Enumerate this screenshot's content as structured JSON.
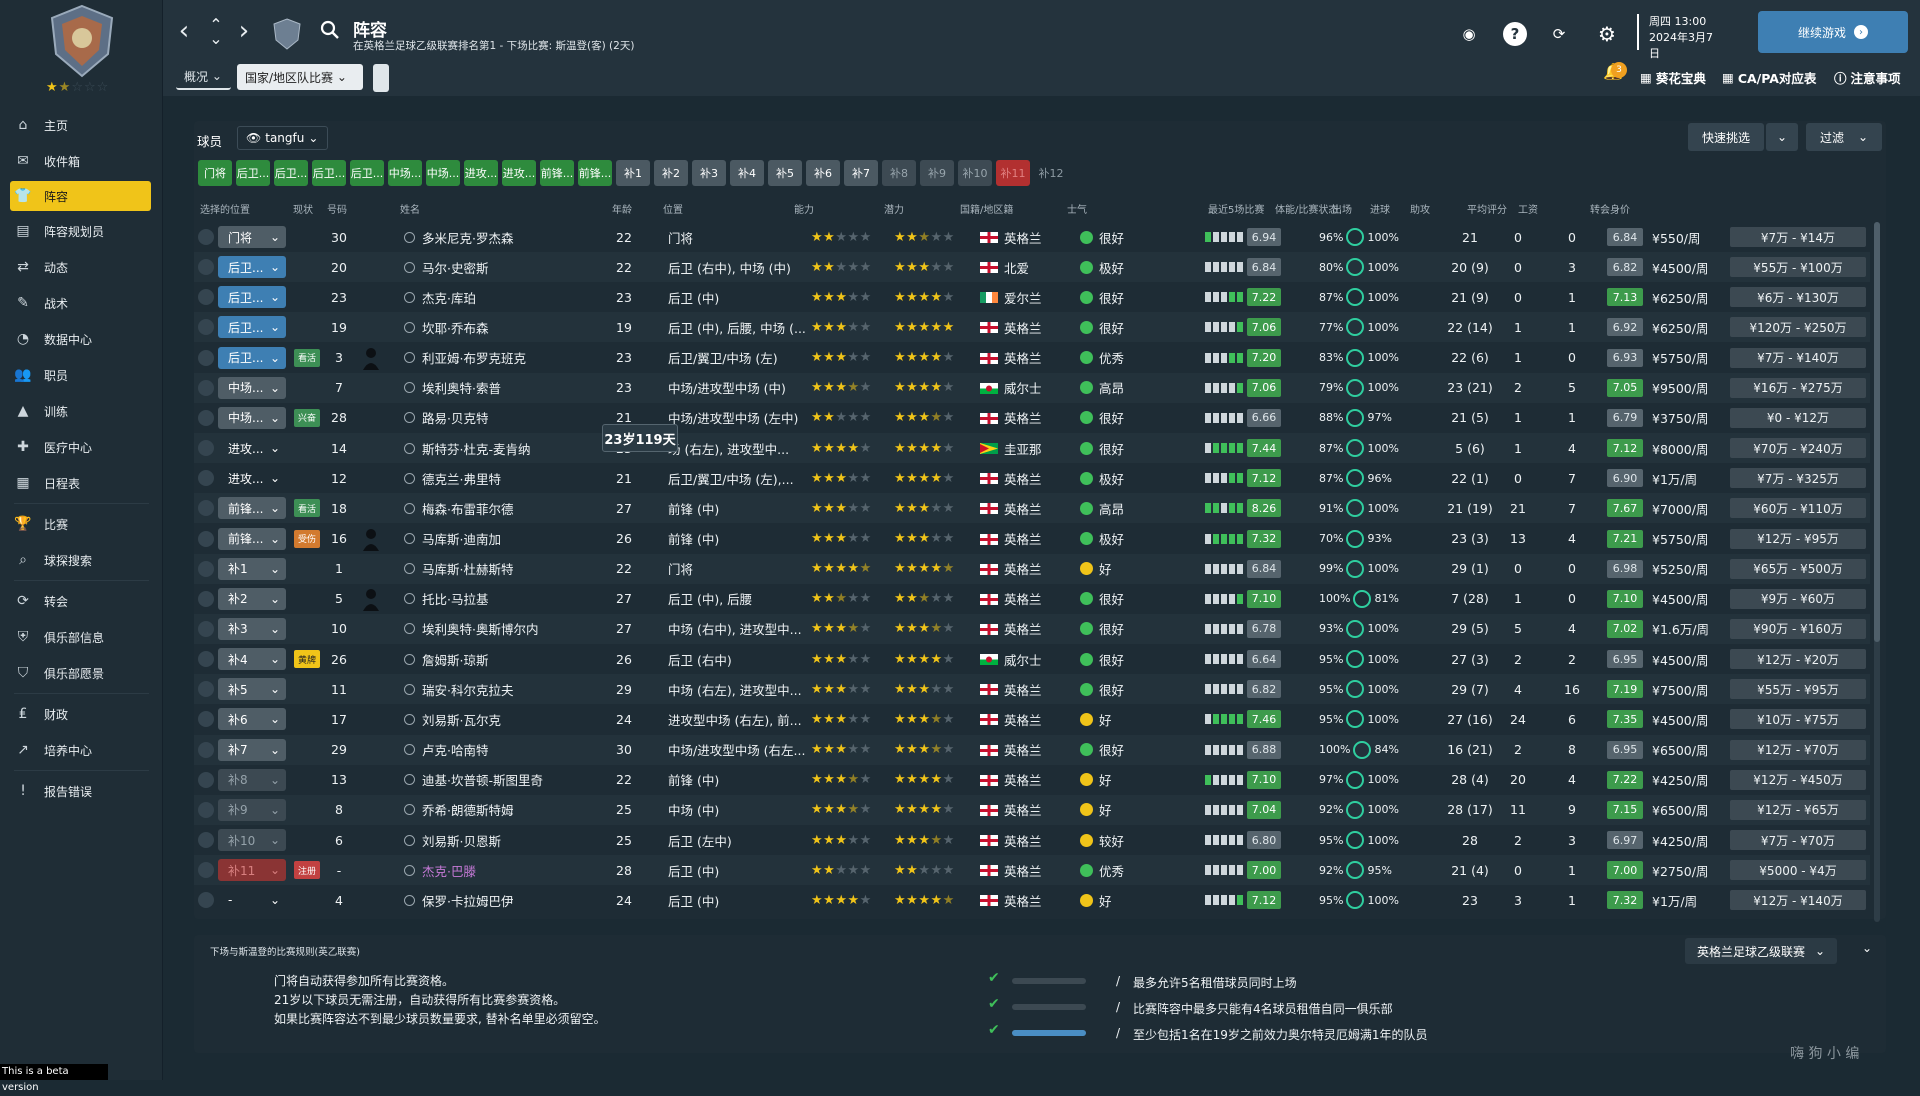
{
  "sidebar": {
    "stars": {
      "filled": "★",
      "half": "★",
      "empty": "☆☆☆"
    },
    "items": [
      {
        "label": "主页",
        "icon": "home-icon"
      },
      {
        "label": "收件箱",
        "icon": "inbox-icon"
      },
      {
        "label": "阵容",
        "icon": "squad-icon",
        "active": true
      },
      {
        "label": "阵容规划员",
        "icon": "planner-icon"
      },
      {
        "label": "动态",
        "icon": "dynamics-icon"
      },
      {
        "label": "战术",
        "icon": "tactics-icon"
      },
      {
        "label": "数据中心",
        "icon": "data-icon"
      },
      {
        "label": "职员",
        "icon": "staff-icon"
      },
      {
        "label": "训练",
        "icon": "training-icon"
      },
      {
        "label": "医疗中心",
        "icon": "medical-icon"
      },
      {
        "label": "日程表",
        "icon": "calendar-icon"
      },
      {
        "label": "比赛",
        "icon": "trophy-icon"
      },
      {
        "label": "球探搜索",
        "icon": "scout-icon"
      },
      {
        "label": "转会",
        "icon": "transfer-icon"
      },
      {
        "label": "俱乐部信息",
        "icon": "club-info-icon"
      },
      {
        "label": "俱乐部愿景",
        "icon": "vision-icon"
      },
      {
        "label": "财政",
        "icon": "finance-icon"
      },
      {
        "label": "培养中心",
        "icon": "development-icon"
      },
      {
        "label": "报告错误",
        "icon": "report-icon"
      }
    ],
    "beta": "This is a beta version"
  },
  "header": {
    "title": "阵容",
    "subtitle": "在英格兰足球乙级联赛排名第1 - 下场比赛: 斯温登(客) (2天)",
    "date_day": "周四 13:00",
    "date_full": "2024年3月7日",
    "continue": "继续游戏",
    "tabs": [
      {
        "label": "概况"
      },
      {
        "label": "国家/地区队比赛"
      }
    ],
    "links": [
      "葵花宝典",
      "CA/PA对应表",
      "注意事项"
    ],
    "notif_count": "3"
  },
  "panel": {
    "label": "球员",
    "view": "tangfu",
    "quick": "快速挑选",
    "filter": "过滤",
    "pos_tabs": [
      {
        "l": "门将",
        "t": "g"
      },
      {
        "l": "后卫...",
        "t": "g"
      },
      {
        "l": "后卫...",
        "t": "g"
      },
      {
        "l": "后卫...",
        "t": "g"
      },
      {
        "l": "后卫...",
        "t": "g"
      },
      {
        "l": "中场...",
        "t": "g"
      },
      {
        "l": "中场...",
        "t": "g"
      },
      {
        "l": "进攻...",
        "t": "g"
      },
      {
        "l": "进攻...",
        "t": "g"
      },
      {
        "l": "前锋...",
        "t": "g"
      },
      {
        "l": "前锋...",
        "t": "g"
      },
      {
        "l": "补1",
        "t": "s"
      },
      {
        "l": "补2",
        "t": "s"
      },
      {
        "l": "补3",
        "t": "s"
      },
      {
        "l": "补4",
        "t": "s"
      },
      {
        "l": "补5",
        "t": "s"
      },
      {
        "l": "补6",
        "t": "s"
      },
      {
        "l": "补7",
        "t": "s"
      },
      {
        "l": "补8",
        "t": "s2"
      },
      {
        "l": "补9",
        "t": "s2"
      },
      {
        "l": "补10",
        "t": "s2"
      },
      {
        "l": "补11",
        "t": "r"
      },
      {
        "l": "补12",
        "t": "n"
      }
    ],
    "columns": [
      "选择的位置",
      "现状",
      "号码",
      "姓名",
      "年龄",
      "位置",
      "能力",
      "潜力",
      "国籍/地区籍",
      "士气",
      "最近5场比赛",
      "体能/比赛状态",
      "出场",
      "进球",
      "助攻",
      "平均评分",
      "工资",
      "转会身价"
    ]
  },
  "tooltip": "23岁119天",
  "players": [
    {
      "sel": "门将",
      "sc": "gray",
      "badge": "",
      "bc": "",
      "num": "30",
      "sil": false,
      "name": "多米尼克·罗杰森",
      "age": "22",
      "pos": "门将",
      "ab": 2,
      "abh": 0,
      "po": 2,
      "poh": 1,
      "flag": "eng",
      "nat": "英格兰",
      "mor": "很好",
      "mc": "#3fbf5a",
      "fb": [
        1,
        0,
        0,
        0,
        0
      ],
      "fr": "6.94",
      "frc": "gray",
      "fit": "96%",
      "cond": "100%",
      "apps": "21",
      "g": "0",
      "a": "0",
      "avg": "6.84",
      "avgc": "gray",
      "wage": "¥550/周",
      "val": "¥7万 - ¥14万"
    },
    {
      "sel": "后卫...",
      "sc": "blue",
      "badge": "",
      "bc": "",
      "num": "20",
      "sil": false,
      "name": "马尔·史密斯",
      "age": "22",
      "pos": "后卫 (右中), 中场 (中)",
      "ab": 2,
      "abh": 0,
      "po": 3,
      "poh": 0,
      "flag": "nir",
      "nat": "北爱",
      "mor": "极好",
      "mc": "#3fbf5a",
      "fb": [
        0,
        0,
        0,
        0,
        0
      ],
      "fr": "6.84",
      "frc": "gray",
      "fit": "80%",
      "cond": "100%",
      "apps": "20 (9)",
      "g": "0",
      "a": "3",
      "avg": "6.82",
      "avgc": "gray",
      "wage": "¥4500/周",
      "val": "¥55万 - ¥100万"
    },
    {
      "sel": "后卫...",
      "sc": "blue",
      "badge": "",
      "bc": "",
      "num": "23",
      "sil": false,
      "name": "杰克·库珀",
      "age": "23",
      "pos": "后卫 (中)",
      "ab": 3,
      "abh": 0,
      "po": 4,
      "poh": 0,
      "flag": "irl",
      "nat": "爱尔兰",
      "mor": "很好",
      "mc": "#3fbf5a",
      "fb": [
        0,
        0,
        0,
        1,
        1
      ],
      "fr": "7.22",
      "frc": "green",
      "fit": "87%",
      "cond": "100%",
      "apps": "21 (9)",
      "g": "0",
      "a": "1",
      "avg": "7.13",
      "avgc": "green",
      "wage": "¥6250/周",
      "val": "¥6万 - ¥130万"
    },
    {
      "sel": "后卫...",
      "sc": "blue",
      "badge": "",
      "bc": "",
      "num": "19",
      "sil": false,
      "name": "坎耶·乔布森",
      "age": "19",
      "pos": "后卫 (中), 后腰, 中场 (...",
      "ab": 3,
      "abh": 0,
      "po": 5,
      "poh": 0,
      "flag": "eng",
      "nat": "英格兰",
      "mor": "很好",
      "mc": "#3fbf5a",
      "fb": [
        0,
        0,
        0,
        0,
        1
      ],
      "fr": "7.06",
      "frc": "green",
      "fit": "77%",
      "cond": "100%",
      "apps": "22 (14)",
      "g": "1",
      "a": "1",
      "avg": "6.92",
      "avgc": "gray",
      "wage": "¥6250/周",
      "val": "¥120万 - ¥250万"
    },
    {
      "sel": "后卫...",
      "sc": "blue",
      "badge": "看活",
      "bc": "green",
      "num": "3",
      "sil": true,
      "name": "利亚姆·布罗克班克",
      "age": "23",
      "pos": "后卫/翼卫/中场 (左)",
      "ab": 3,
      "abh": 0,
      "po": 4,
      "poh": 0,
      "flag": "eng",
      "nat": "英格兰",
      "mor": "优秀",
      "mc": "#3fbf5a",
      "fb": [
        0,
        0,
        0,
        1,
        1
      ],
      "fr": "7.20",
      "frc": "green",
      "fit": "83%",
      "cond": "100%",
      "apps": "22 (6)",
      "g": "1",
      "a": "0",
      "avg": "6.93",
      "avgc": "gray",
      "wage": "¥5750/周",
      "val": "¥7万 - ¥140万"
    },
    {
      "sel": "中场...",
      "sc": "gray",
      "badge": "",
      "bc": "",
      "num": "7",
      "sil": false,
      "name": "埃利奥特·索普",
      "age": "23",
      "pos": "中场/进攻型中场 (中)",
      "ab": 3,
      "abh": 1,
      "po": 4,
      "poh": 0,
      "flag": "wal",
      "nat": "威尔士",
      "mor": "高昂",
      "mc": "#3fbf5a",
      "fb": [
        0,
        0,
        0,
        0,
        1
      ],
      "fr": "7.06",
      "frc": "green",
      "fit": "79%",
      "cond": "100%",
      "apps": "23 (21)",
      "g": "2",
      "a": "5",
      "avg": "7.05",
      "avgc": "green",
      "wage": "¥9500/周",
      "val": "¥16万 - ¥275万"
    },
    {
      "sel": "中场...",
      "sc": "gray",
      "badge": "兴奋",
      "bc": "green",
      "num": "28",
      "sil": false,
      "name": "路易·贝克特",
      "age": "21",
      "pos": "中场/进攻型中场 (左中)",
      "ab": 2,
      "abh": 0,
      "po": 3,
      "poh": 1,
      "flag": "eng",
      "nat": "英格兰",
      "mor": "很好",
      "mc": "#3fbf5a",
      "fb": [
        0,
        0,
        0,
        0,
        0
      ],
      "fr": "6.66",
      "frc": "gray",
      "fit": "88%",
      "cond": "97%",
      "apps": "21 (5)",
      "g": "1",
      "a": "1",
      "avg": "6.79",
      "avgc": "gray",
      "wage": "¥3750/周",
      "val": "¥0 - ¥12万"
    },
    {
      "sel": "进攻...",
      "sc": "none",
      "badge": "",
      "bc": "",
      "num": "14",
      "sil": false,
      "name": "斯特芬·杜克-麦肯纳",
      "age": "23",
      "pos": "场 (右左), 进攻型中...",
      "ab": 4,
      "abh": 0,
      "po": 4,
      "poh": 0,
      "flag": "guy",
      "nat": "圭亚那",
      "mor": "很好",
      "mc": "#3fbf5a",
      "fb": [
        0,
        1,
        1,
        1,
        1
      ],
      "fr": "7.44",
      "frc": "green",
      "fit": "87%",
      "cond": "100%",
      "apps": "5 (6)",
      "g": "1",
      "a": "4",
      "avg": "7.12",
      "avgc": "green",
      "wage": "¥8000/周",
      "val": "¥70万 - ¥240万"
    },
    {
      "sel": "进攻...",
      "sc": "none",
      "badge": "",
      "bc": "",
      "num": "12",
      "sil": false,
      "name": "德克兰·弗里特",
      "age": "21",
      "pos": "后卫/翼卫/中场 (左),...",
      "ab": 3,
      "abh": 0,
      "po": 4,
      "poh": 0,
      "flag": "eng",
      "nat": "英格兰",
      "mor": "极好",
      "mc": "#3fbf5a",
      "fb": [
        0,
        0,
        0,
        1,
        1
      ],
      "fr": "7.12",
      "frc": "green",
      "fit": "87%",
      "cond": "96%",
      "apps": "22 (1)",
      "g": "0",
      "a": "7",
      "avg": "6.90",
      "avgc": "gray",
      "wage": "¥1万/周",
      "val": "¥7万 - ¥325万"
    },
    {
      "sel": "前锋...",
      "sc": "gray",
      "badge": "看活",
      "bc": "green",
      "num": "18",
      "sil": false,
      "name": "梅森·布雷菲尔德",
      "age": "27",
      "pos": "前锋 (中)",
      "ab": 3,
      "abh": 0,
      "po": 3,
      "poh": 0,
      "flag": "eng",
      "nat": "英格兰",
      "mor": "高昂",
      "mc": "#3fbf5a",
      "fb": [
        1,
        1,
        0,
        1,
        1
      ],
      "fr": "8.26",
      "frc": "green",
      "fit": "91%",
      "cond": "100%",
      "apps": "21 (19)",
      "g": "21",
      "a": "7",
      "avg": "7.67",
      "avgc": "green",
      "wage": "¥7000/周",
      "val": "¥60万 - ¥110万"
    },
    {
      "sel": "前锋...",
      "sc": "gray",
      "badge": "受伤",
      "bc": "orange",
      "num": "16",
      "sil": true,
      "name": "马库斯·迪南加",
      "age": "26",
      "pos": "前锋 (中)",
      "ab": 3,
      "abh": 0,
      "po": 3,
      "poh": 0,
      "flag": "eng",
      "nat": "英格兰",
      "mor": "极好",
      "mc": "#3fbf5a",
      "fb": [
        0,
        1,
        1,
        1,
        1
      ],
      "fr": "7.32",
      "frc": "green",
      "fit": "70%",
      "cond": "93%",
      "apps": "23 (3)",
      "g": "13",
      "a": "4",
      "avg": "7.21",
      "avgc": "green",
      "wage": "¥5750/周",
      "val": "¥12万 - ¥95万"
    },
    {
      "sel": "补1",
      "sc": "gray",
      "badge": "",
      "bc": "",
      "num": "1",
      "sil": false,
      "name": "马库斯·杜赫斯特",
      "age": "22",
      "pos": "门将",
      "ab": 4,
      "abh": 1,
      "po": 4,
      "poh": 1,
      "flag": "eng",
      "nat": "英格兰",
      "mor": "好",
      "mc": "#f0c419",
      "fb": [
        0,
        0,
        0,
        0,
        0
      ],
      "fr": "6.84",
      "frc": "gray",
      "fit": "99%",
      "cond": "100%",
      "apps": "29 (1)",
      "g": "0",
      "a": "0",
      "avg": "6.98",
      "avgc": "gray",
      "wage": "¥5250/周",
      "val": "¥65万 - ¥500万"
    },
    {
      "sel": "补2",
      "sc": "gray",
      "badge": "",
      "bc": "",
      "num": "5",
      "sil": true,
      "name": "托比·马拉基",
      "age": "27",
      "pos": "后卫 (中), 后腰",
      "ab": 2,
      "abh": 1,
      "po": 2,
      "poh": 1,
      "flag": "eng",
      "nat": "英格兰",
      "mor": "很好",
      "mc": "#3fbf5a",
      "fb": [
        0,
        0,
        0,
        0,
        1
      ],
      "fr": "7.10",
      "frc": "green",
      "fit": "100%",
      "cond": "81%",
      "apps": "7 (28)",
      "g": "1",
      "a": "0",
      "avg": "7.10",
      "avgc": "green",
      "wage": "¥4500/周",
      "val": "¥9万 - ¥60万"
    },
    {
      "sel": "补3",
      "sc": "gray",
      "badge": "",
      "bc": "",
      "num": "10",
      "sil": false,
      "name": "埃利奥特·奥斯博尔内",
      "age": "27",
      "pos": "中场 (右中), 进攻型中...",
      "ab": 3,
      "abh": 1,
      "po": 3,
      "poh": 1,
      "flag": "eng",
      "nat": "英格兰",
      "mor": "很好",
      "mc": "#3fbf5a",
      "fb": [
        0,
        0,
        0,
        0,
        0
      ],
      "fr": "6.78",
      "frc": "gray",
      "fit": "93%",
      "cond": "100%",
      "apps": "29 (5)",
      "g": "5",
      "a": "4",
      "avg": "7.02",
      "avgc": "green",
      "wage": "¥1.6万/周",
      "val": "¥90万 - ¥160万"
    },
    {
      "sel": "补4",
      "sc": "gray",
      "badge": "黄牌",
      "bc": "yellow",
      "num": "26",
      "sil": false,
      "name": "詹姆斯·琼斯",
      "age": "26",
      "pos": "后卫 (右中)",
      "ab": 3,
      "abh": 0,
      "po": 4,
      "poh": 0,
      "flag": "wal",
      "nat": "威尔士",
      "mor": "很好",
      "mc": "#3fbf5a",
      "fb": [
        0,
        0,
        0,
        0,
        0
      ],
      "fr": "6.64",
      "frc": "gray",
      "fit": "95%",
      "cond": "100%",
      "apps": "27 (3)",
      "g": "2",
      "a": "2",
      "avg": "6.95",
      "avgc": "gray",
      "wage": "¥4500/周",
      "val": "¥12万 - ¥20万"
    },
    {
      "sel": "补5",
      "sc": "gray",
      "badge": "",
      "bc": "",
      "num": "11",
      "sil": false,
      "name": "瑞安·科尔克拉夫",
      "age": "29",
      "pos": "中场 (右左), 进攻型中...",
      "ab": 3,
      "abh": 0,
      "po": 3,
      "poh": 0,
      "flag": "eng",
      "nat": "英格兰",
      "mor": "很好",
      "mc": "#3fbf5a",
      "fb": [
        0,
        0,
        0,
        0,
        0
      ],
      "fr": "6.82",
      "frc": "gray",
      "fit": "95%",
      "cond": "100%",
      "apps": "29 (7)",
      "g": "4",
      "a": "16",
      "avg": "7.19",
      "avgc": "green",
      "wage": "¥7500/周",
      "val": "¥55万 - ¥95万"
    },
    {
      "sel": "补6",
      "sc": "gray",
      "badge": "",
      "bc": "",
      "num": "17",
      "sil": false,
      "name": "刘易斯·瓦尔克",
      "age": "24",
      "pos": "进攻型中场 (右左), 前...",
      "ab": 3,
      "abh": 0,
      "po": 3,
      "poh": 1,
      "flag": "eng",
      "nat": "英格兰",
      "mor": "好",
      "mc": "#f0c419",
      "fb": [
        0,
        1,
        1,
        1,
        1
      ],
      "fr": "7.46",
      "frc": "green",
      "fit": "95%",
      "cond": "100%",
      "apps": "27 (16)",
      "g": "24",
      "a": "6",
      "avg": "7.35",
      "avgc": "green",
      "wage": "¥4500/周",
      "val": "¥10万 - ¥75万"
    },
    {
      "sel": "补7",
      "sc": "gray",
      "badge": "",
      "bc": "",
      "num": "29",
      "sil": false,
      "name": "卢克·哈南特",
      "age": "30",
      "pos": "中场/进攻型中场 (右左...",
      "ab": 3,
      "abh": 0,
      "po": 3,
      "poh": 1,
      "flag": "eng",
      "nat": "英格兰",
      "mor": "很好",
      "mc": "#3fbf5a",
      "fb": [
        0,
        0,
        0,
        0,
        0
      ],
      "fr": "6.88",
      "frc": "gray",
      "fit": "100%",
      "cond": "84%",
      "apps": "16 (21)",
      "g": "2",
      "a": "8",
      "avg": "6.95",
      "avgc": "gray",
      "wage": "¥6500/周",
      "val": "¥12万 - ¥70万"
    },
    {
      "sel": "补8",
      "sc": "dgray",
      "badge": "",
      "bc": "",
      "num": "13",
      "sil": false,
      "name": "迪基·坎普顿-斯图里奇",
      "age": "22",
      "pos": "前锋 (中)",
      "ab": 3,
      "abh": 1,
      "po": 4,
      "poh": 0,
      "flag": "eng",
      "nat": "英格兰",
      "mor": "好",
      "mc": "#f0c419",
      "fb": [
        1,
        0,
        0,
        0,
        0
      ],
      "fr": "7.10",
      "frc": "green",
      "fit": "97%",
      "cond": "100%",
      "apps": "28 (4)",
      "g": "20",
      "a": "4",
      "avg": "7.22",
      "avgc": "green",
      "wage": "¥4250/周",
      "val": "¥12万 - ¥450万"
    },
    {
      "sel": "补9",
      "sc": "dgray",
      "badge": "",
      "bc": "",
      "num": "8",
      "sil": false,
      "name": "乔希·朗德斯特姆",
      "age": "25",
      "pos": "中场 (中)",
      "ab": 3,
      "abh": 1,
      "po": 4,
      "poh": 0,
      "flag": "eng",
      "nat": "英格兰",
      "mor": "好",
      "mc": "#f0c419",
      "fb": [
        0,
        0,
        0,
        0,
        0
      ],
      "fr": "7.04",
      "frc": "green",
      "fit": "92%",
      "cond": "100%",
      "apps": "28 (17)",
      "g": "11",
      "a": "9",
      "avg": "7.15",
      "avgc": "green",
      "wage": "¥6500/周",
      "val": "¥12万 - ¥65万"
    },
    {
      "sel": "补10",
      "sc": "dgray",
      "badge": "",
      "bc": "",
      "num": "6",
      "sil": false,
      "name": "刘易斯·贝恩斯",
      "age": "25",
      "pos": "后卫 (左中)",
      "ab": 3,
      "abh": 0,
      "po": 3,
      "poh": 1,
      "flag": "eng",
      "nat": "英格兰",
      "mor": "较好",
      "mc": "#f0c419",
      "fb": [
        0,
        0,
        0,
        0,
        0
      ],
      "fr": "6.80",
      "frc": "gray",
      "fit": "95%",
      "cond": "100%",
      "apps": "28",
      "g": "2",
      "a": "3",
      "avg": "6.97",
      "avgc": "gray",
      "wage": "¥4250/周",
      "val": "¥7万 - ¥70万"
    },
    {
      "sel": "补11",
      "sc": "red",
      "badge": "注册",
      "bc": "red",
      "num": "-",
      "sil": false,
      "name": "杰克·巴滕",
      "age": "28",
      "pos": "后卫 (中)",
      "ab": 2,
      "abh": 0,
      "po": 2,
      "poh": 0,
      "flag": "eng",
      "nat": "英格兰",
      "mor": "优秀",
      "mc": "#3fbf5a",
      "fb": [
        0,
        0,
        0,
        0,
        0
      ],
      "fr": "7.00",
      "frc": "green",
      "fit": "92%",
      "cond": "95%",
      "apps": "21 (4)",
      "g": "0",
      "a": "1",
      "avg": "7.00",
      "avgc": "green",
      "wage": "¥2750/周",
      "val": "¥5000 - ¥4万",
      "namecolor": "#c77ad8"
    },
    {
      "sel": "-",
      "sc": "none",
      "badge": "",
      "bc": "",
      "num": "4",
      "sil": false,
      "name": "保罗·卡拉姆巴伊",
      "age": "24",
      "pos": "后卫 (中)",
      "ab": 4,
      "abh": 0,
      "po": 4,
      "poh": 1,
      "flag": "eng",
      "nat": "英格兰",
      "mor": "好",
      "mc": "#f0c419",
      "fb": [
        0,
        0,
        0,
        0,
        1
      ],
      "fr": "7.12",
      "frc": "green",
      "fit": "95%",
      "cond": "100%",
      "apps": "23",
      "g": "3",
      "a": "1",
      "avg": "7.32",
      "avgc": "green",
      "wage": "¥1万/周",
      "val": "¥12万 - ¥140万"
    }
  ],
  "rules": {
    "title": "下场与斯温登的比赛规则(英乙联赛)",
    "left": [
      "门将自动获得参加所有比赛资格。",
      "21岁以下球员无需注册，自动获得所有比赛参赛资格。",
      "如果比赛阵容达不到最少球员数量要求, 替补名单里必须留空。"
    ],
    "right": [
      {
        "text": "最多允许5名租借球员同时上场",
        "fill": 0
      },
      {
        "text": "比赛阵容中最多只能有4名球员租借自同一俱乐部",
        "fill": 0
      },
      {
        "text": "至少包括1名在19岁之前效力奥尔特灵厄姆满1年的队员",
        "fill": 1
      }
    ],
    "league": "英格兰足球乙级联赛"
  },
  "watermark": "嗨 狗 小 编"
}
